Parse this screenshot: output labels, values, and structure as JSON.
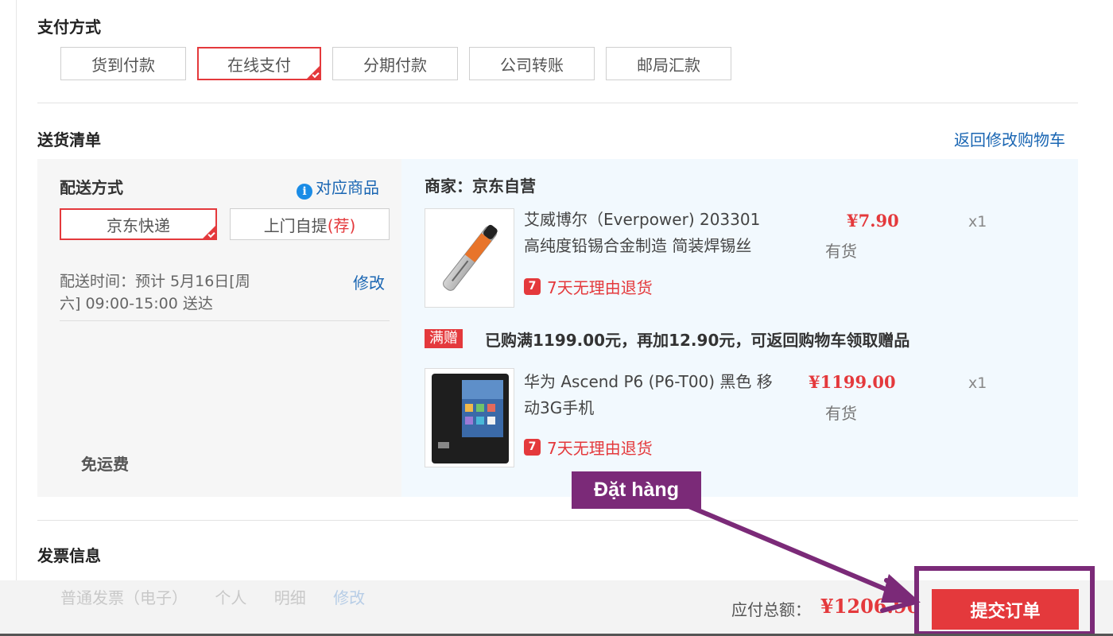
{
  "payment": {
    "title": "支付方式",
    "options": [
      "货到付款",
      "在线支付",
      "分期付款",
      "公司转账",
      "邮局汇款"
    ],
    "selected": "在线支付"
  },
  "delivery_list": {
    "title": "送货清单",
    "back_link": "返回修改购物车"
  },
  "shipping": {
    "title": "配送方式",
    "matching_goods_link": "对应商品",
    "option_express": "京东快递",
    "option_pickup": "上门自提",
    "option_pickup_tag": "(荐)",
    "time_text_line1": "配送时间：预计 5月16日[周",
    "time_text_line2": "六] 09:00-15:00 送达",
    "edit_link": "修改",
    "free_shipping": "免运费"
  },
  "goods": {
    "seller": "商家：京东自营",
    "items": [
      {
        "name_line1": "艾威博尔（Everpower) 203301",
        "name_line2": "高纯度铅锡合金制造 简装焊锡丝",
        "price": "¥7.90",
        "stock": "有货",
        "qty": "x1",
        "return_policy": "7天无理由退货",
        "return_badge": "7"
      },
      {
        "name_line1": "华为 Ascend P6 (P6-T00) 黑色 移",
        "name_line2": "动3G手机",
        "price": "¥1199.00",
        "stock": "有货",
        "qty": "x1",
        "return_policy": "7天无理由退货",
        "return_badge": "7"
      }
    ],
    "promo_tag": "满赠",
    "promo_text": "已购满1199.00元，再加12.90元，可返回购物车领取赠品"
  },
  "invoice": {
    "title": "发票信息",
    "type": "普通发票（电子）",
    "title_type": "个人",
    "content": "明细",
    "edit_link": "修改"
  },
  "summary": {
    "total_label": "应付总额：",
    "total_value": "¥1206.90",
    "submit_label": "提交订单"
  },
  "annotation": {
    "callout_text": "Đặt hàng",
    "color": "#7b2a78"
  },
  "colors": {
    "accent_red": "#e4393c",
    "link_blue": "#1a66b3",
    "goods_panel_bg": "#f2f9fe"
  }
}
